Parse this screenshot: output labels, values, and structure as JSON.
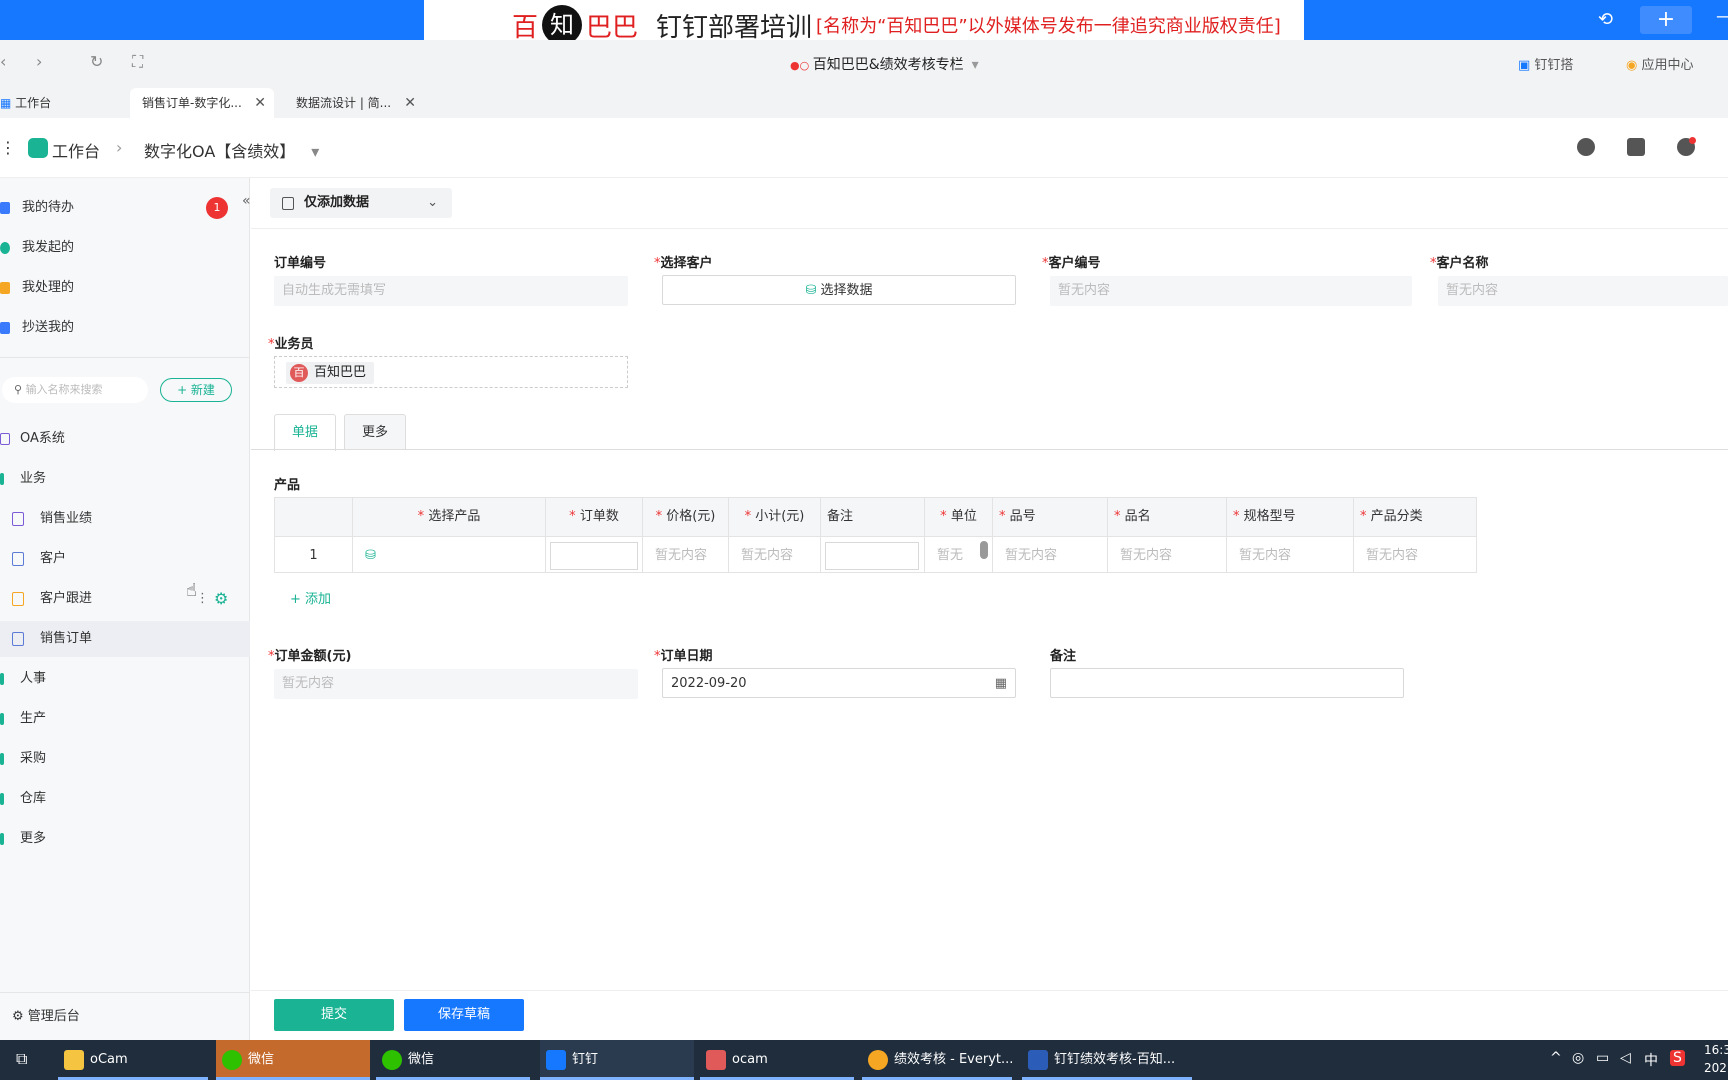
{
  "banner": {
    "part1": "百",
    "part2": "知",
    "part3": "巴巴",
    "title": "钉钉部署培训",
    "notice": "[名称为“百知巴巴”以外媒体号发布一律追究商业版权责任]"
  },
  "browser": {
    "org_title": "百知巴巴&绩效考核专栏",
    "right_items": [
      "钉钉搭",
      "应用中心"
    ],
    "tabs": [
      {
        "label": "工作台",
        "active": false
      },
      {
        "label": "销售订单-数字化...",
        "active": true
      },
      {
        "label": "数据流设计 | 简...",
        "active": false
      }
    ]
  },
  "app_header": {
    "home": "工作台",
    "app_name": "数字化OA【含绩效】"
  },
  "sidebar": {
    "top_items": [
      {
        "label": "我的待办",
        "color": "#3a7afe"
      },
      {
        "label": "我发起的",
        "color": "#1ab394"
      },
      {
        "label": "我处理的",
        "color": "#f5a623"
      },
      {
        "label": "抄送我的",
        "color": "#3a7afe"
      }
    ],
    "todo_badge": "1",
    "search_placeholder": "输入名称来搜索",
    "new_button": "+ 新建",
    "groups": [
      {
        "label": "OA系统",
        "color": "#7b5cd6"
      },
      {
        "label": "业务",
        "color": "#1ab394"
      }
    ],
    "business_items": [
      "销售业绩",
      "客户",
      "客户跟进",
      "销售订单"
    ],
    "bottom_groups": [
      "人事",
      "生产",
      "采购",
      "仓库",
      "更多"
    ],
    "admin": "管理后台"
  },
  "form": {
    "mode_select": "仅添加数据",
    "fields": {
      "order_no": {
        "label": "订单编号",
        "placeholder": "自动生成无需填写"
      },
      "customer": {
        "label": "选择客户",
        "button": "选择数据"
      },
      "customer_no": {
        "label": "客户编号",
        "placeholder": "暂无内容"
      },
      "customer_name": {
        "label": "客户名称",
        "placeholder": "暂无内容"
      },
      "salesperson": {
        "label": "业务员",
        "value": "百知巴巴",
        "avatar": "百"
      }
    },
    "tabs": [
      "单据",
      "更多"
    ],
    "product_section": "产品",
    "table": {
      "columns": [
        "选择产品",
        "订单数",
        "价格(元)",
        "小计(元)",
        "备注",
        "单位",
        "品号",
        "品名",
        "规格型号",
        "产品分类"
      ],
      "required": [
        true,
        true,
        true,
        true,
        false,
        true,
        true,
        true,
        true,
        true
      ],
      "row_index": "1",
      "empty": "暂无内容",
      "unit_cell": "暂无"
    },
    "add_row": "+ 添加",
    "amount": {
      "label": "订单金额(元)",
      "placeholder": "暂无内容"
    },
    "date": {
      "label": "订单日期",
      "value": "2022-09-20"
    },
    "remark": {
      "label": "备注"
    },
    "submit": "提交",
    "save_draft": "保存草稿"
  },
  "taskbar": {
    "items": [
      "oCam",
      "微信",
      "微信",
      "钉钉",
      "ocam",
      "绩效考核 - Everyt...",
      "钉钉绩效考核-百知..."
    ],
    "tray_text": "中",
    "clock": "16:3",
    "date": "202"
  },
  "colors": {
    "accent": "#1ab394",
    "blue": "#1677ff",
    "required": "#e33333"
  }
}
